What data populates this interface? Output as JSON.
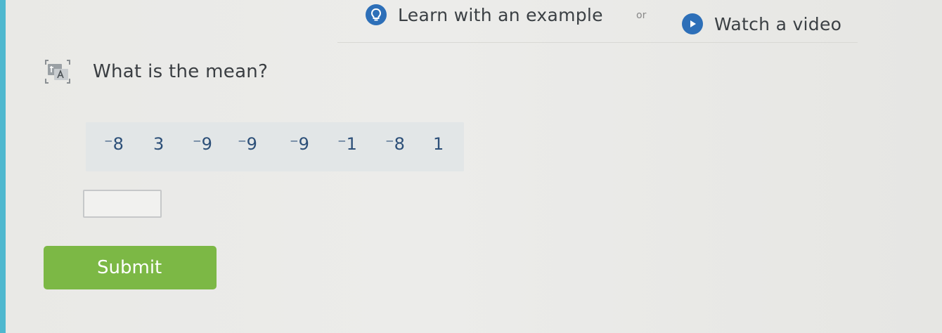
{
  "header": {
    "learn_link_label": "Learn with an example",
    "or_label": "or",
    "video_link_label": "Watch a video"
  },
  "question": {
    "prompt": "What is the mean?",
    "values": [
      "⁻8",
      "3",
      "⁻9",
      "⁻9",
      "⁻9",
      "⁻1",
      "⁻8",
      "1"
    ]
  },
  "answer": {
    "value": ""
  },
  "submit": {
    "label": "Submit"
  },
  "colors": {
    "accent_blue": "#2d6fb8",
    "submit_green": "#7cb845",
    "value_text": "#2c4f78",
    "left_strip": "#4fb8cf"
  },
  "icons": {
    "learn": "lightbulb-icon",
    "video": "play-icon",
    "translate": "translate-icon"
  }
}
